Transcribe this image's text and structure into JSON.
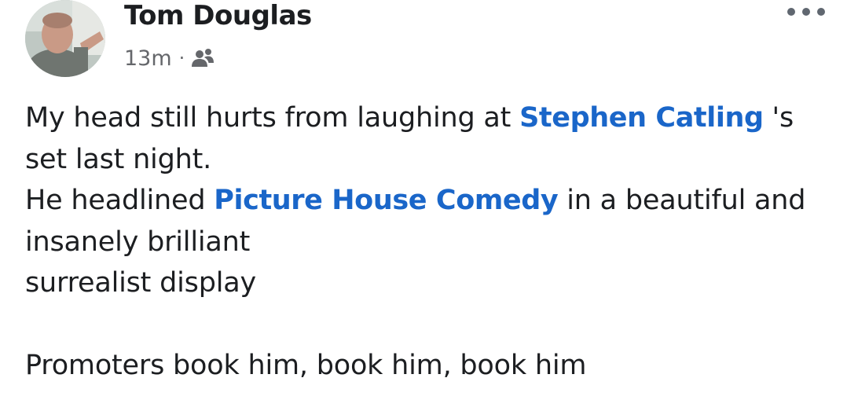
{
  "author": {
    "name": "Tom Douglas",
    "timestamp": "13m",
    "separator": "·",
    "audience_icon": "friends-icon"
  },
  "more_button": {
    "icon": "more-options-icon"
  },
  "post": {
    "line1_before": "My head still hurts from laughing at ",
    "mention1": "Stephen Catling",
    "line1_after": " 's",
    "line2": "set last night.",
    "line3_before": "He headlined ",
    "mention2": "Picture House Comedy",
    "line3_after": " in a beautiful and",
    "line4": "insanely brilliant",
    "line5": "surrealist display",
    "line6": "Promoters book him, book him, book him"
  },
  "colors": {
    "link": "#1a66c9",
    "text": "#1c1e21",
    "meta": "#65676b"
  }
}
